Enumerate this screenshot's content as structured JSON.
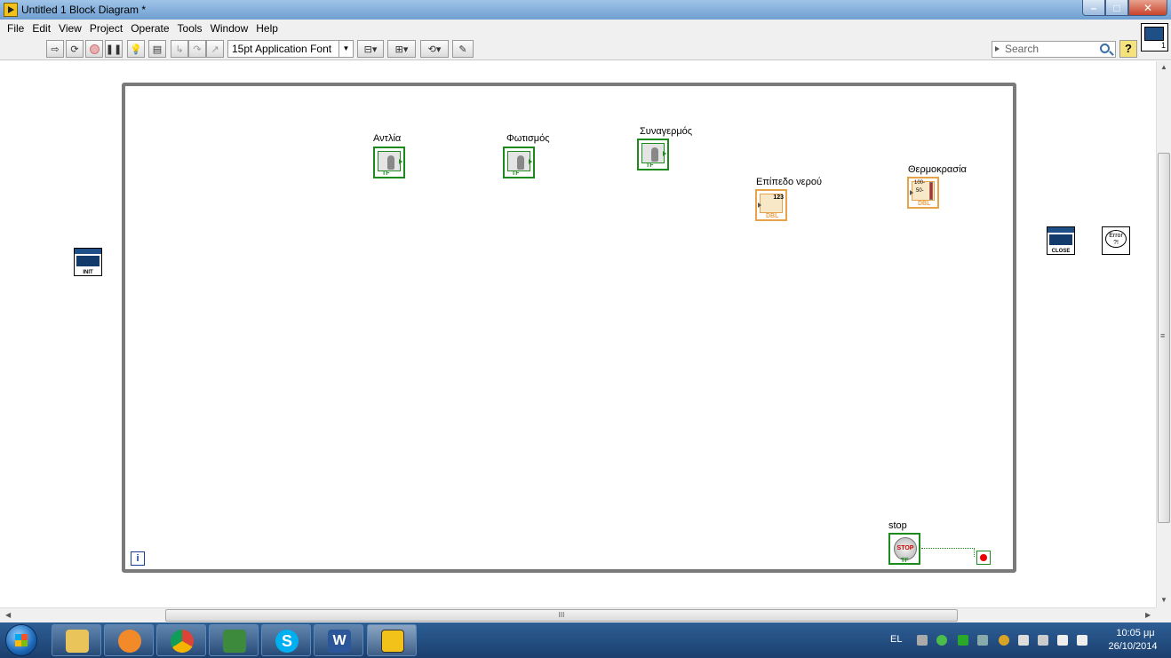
{
  "window": {
    "title": "Untitled 1 Block Diagram *"
  },
  "menu": [
    "File",
    "Edit",
    "View",
    "Project",
    "Operate",
    "Tools",
    "Window",
    "Help"
  ],
  "toolbar": {
    "font": "15pt Application Font",
    "search_placeholder": "Search",
    "help": "?",
    "vi_icon_number": "1"
  },
  "diagram": {
    "loop_iteration": "i",
    "controls": {
      "pump": "Αντλία",
      "lighting": "Φωτισμός",
      "alarm": "Συναγερμός",
      "water_level": "Επίπεδο νερού",
      "temperature": "Θερμοκρασία",
      "stop": "stop"
    },
    "stop_button_text": "STOP",
    "bool_terminal": "TF",
    "numeric_terminal": "123",
    "dbl_terminal": "DBL",
    "thermo_scale": [
      "100-",
      "50-"
    ],
    "subvis": {
      "init": "INIT",
      "close": "CLOSE",
      "error": "Error ?!"
    }
  },
  "scroll": {
    "grip": "III",
    "vgrip": "≡"
  },
  "taskbar": {
    "lang": "EL",
    "time": "10:05 μμ",
    "date": "26/10/2014",
    "apps": [
      "file-explorer",
      "media-player",
      "chrome",
      "device-manager",
      "skype",
      "word",
      "labview"
    ]
  },
  "colors": {
    "bool": "#1c8a1c",
    "numeric": "#e8a24a",
    "loop": "#7a7a7a",
    "titlebar": "#6f9fd1"
  }
}
